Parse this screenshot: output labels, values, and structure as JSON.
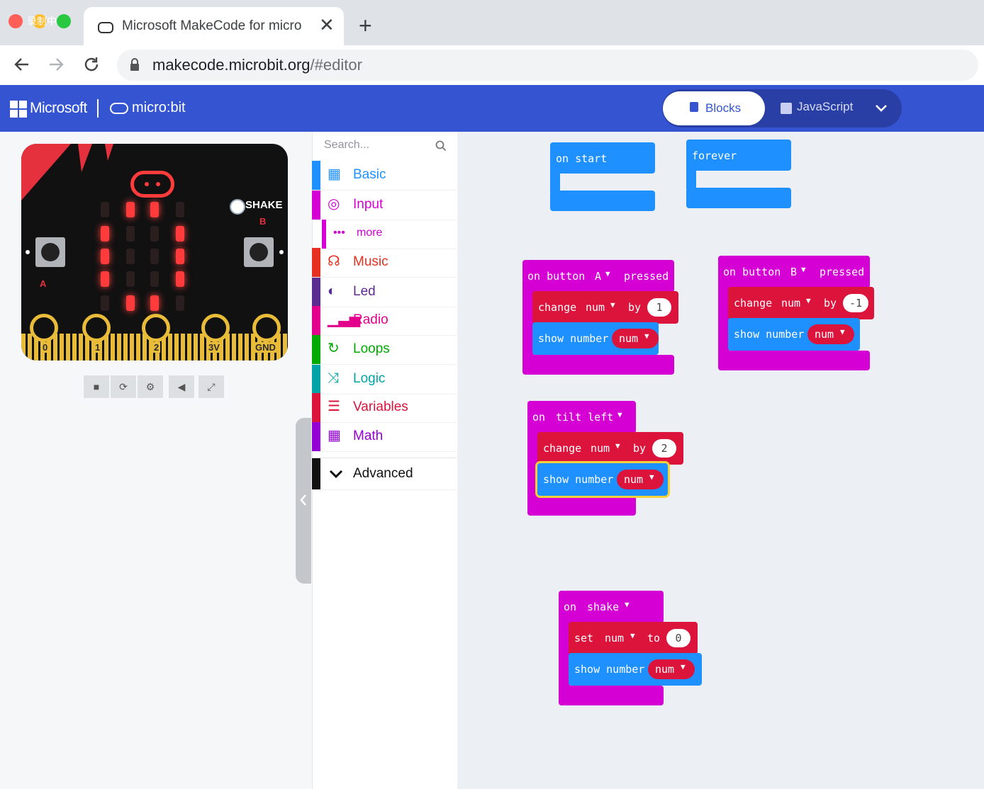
{
  "browser": {
    "tab_title": "Microsoft MakeCode for micro",
    "tab_close": "✕",
    "new_tab": "+",
    "url_host": "makecode.microbit.org",
    "url_path": "/#editor",
    "record_badge": "录制中"
  },
  "header": {
    "brand": "Microsoft",
    "product": "micro:bit",
    "blocks_label": "Blocks",
    "javascript_label": "JavaScript"
  },
  "simulator": {
    "shake_label": "SHAKE",
    "pins": [
      "0",
      "1",
      "2",
      "3V",
      "GND"
    ],
    "button_a": "A",
    "button_b": "B"
  },
  "toolbox": {
    "search_placeholder": "Search...",
    "categories": [
      {
        "label": "Basic",
        "color": "#1e90ff"
      },
      {
        "label": "Input",
        "color": "#d400d4"
      },
      {
        "label": "more",
        "color": "#d400d4"
      },
      {
        "label": "Music",
        "color": "#e63022"
      },
      {
        "label": "Led",
        "color": "#5c2d91"
      },
      {
        "label": "Radio",
        "color": "#e3008c"
      },
      {
        "label": "Loops",
        "color": "#00aa00"
      },
      {
        "label": "Logic",
        "color": "#00a4a6"
      },
      {
        "label": "Variables",
        "color": "#dc143c"
      },
      {
        "label": "Math",
        "color": "#9400d3"
      },
      {
        "label": "Advanced",
        "color": "#000000"
      }
    ]
  },
  "blocks": {
    "on_start": "on start",
    "forever": "forever",
    "btnA": {
      "on": "on button",
      "button": "A",
      "pressed": "pressed",
      "change": "change",
      "var": "num",
      "by": "by",
      "value": "1",
      "show": "show number",
      "show_var": "num"
    },
    "btnB": {
      "on": "on button",
      "button": "B",
      "pressed": "pressed",
      "change": "change",
      "var": "num",
      "by": "by",
      "value": "-1",
      "show": "show number",
      "show_var": "num"
    },
    "tilt": {
      "on": "on",
      "gesture": "tilt left",
      "change": "change",
      "var": "num",
      "by": "by",
      "value": "2",
      "show": "show number",
      "show_var": "num"
    },
    "shake": {
      "on": "on",
      "gesture": "shake",
      "set": "set",
      "var": "num",
      "to": "to",
      "value": "0",
      "show": "show number",
      "show_var": "num"
    }
  },
  "colors": {
    "header": "#3454d1",
    "basic_block": "#1e90ff",
    "input_block": "#d400d4",
    "variable_block": "#dc143c",
    "board_gold": "#e8bb39"
  }
}
